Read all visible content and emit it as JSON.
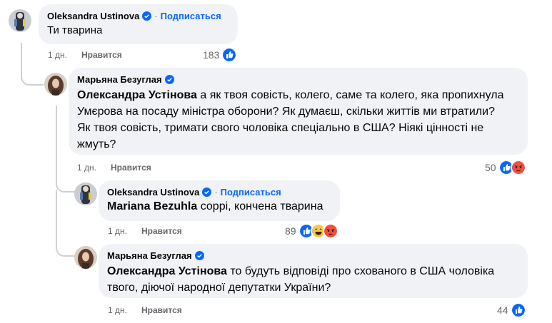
{
  "comments": [
    {
      "author": "Oleksandra Ustinova",
      "follow": "Подписаться",
      "mention": "",
      "text": "Ти тварина",
      "time": "1 дн.",
      "like": "Нравится",
      "reaction_count": "183",
      "reactions": [
        "like-icon"
      ]
    },
    {
      "author": "Марьяна Безуглая",
      "mention": "Олександра Устінова",
      "text_lines": [
        " а як твоя совість, колего, саме та колего, яка пропихнула",
        "Умєрова на посаду міністра оборони? Як думаєш, скільки життів ми втратили?",
        "Як твоя совість, тримати свого чоловіка спеціально в США? Ніякі цінності не",
        "жмуть?"
      ],
      "time": "1 дн.",
      "like": "Нравится",
      "reaction_count": "50",
      "reactions": [
        "like-icon",
        "angry-icon"
      ]
    },
    {
      "author": "Oleksandra Ustinova",
      "follow": "Подписаться",
      "mention": "Mariana Bezuhla",
      "text": " соррі, кончена тварина",
      "time": "1 дн.",
      "like": "Нравится",
      "reaction_count": "89",
      "reactions": [
        "like-icon",
        "haha-icon",
        "angry-icon"
      ]
    },
    {
      "author": "Марьяна Безуглая",
      "mention": "Олександра Устінова",
      "text_lines": [
        " то будуть відповіді про схованого в США чоловіка",
        "твого, діючої народної депутатки України?"
      ],
      "time": "1 дн.",
      "like": "Нравится",
      "reaction_count": "44",
      "reactions": [
        "like-icon"
      ]
    }
  ],
  "colors": {
    "bubble": "#f0f2f5",
    "link": "#0866ff",
    "meta": "#65676b",
    "line": "#ced0d4"
  }
}
